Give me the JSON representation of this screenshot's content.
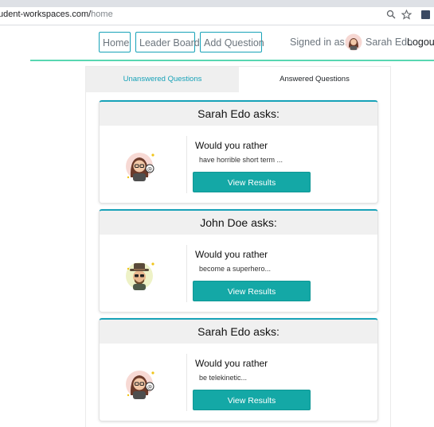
{
  "browser": {
    "url_host": "udent-workspaces.com/",
    "url_path": "home",
    "icons": [
      "zoom-icon",
      "star-icon",
      "extension-icon"
    ]
  },
  "nav": {
    "home_label": "Home",
    "leaderboard_label": "Leader Board",
    "add_question_label": "Add Question",
    "signed_in_label": "Signed in as:",
    "user_name": "Sarah Edo",
    "logout_label": "Logout",
    "accent_color": "#17a2b8"
  },
  "tabs": {
    "unanswered_label": "Unanswered Questions",
    "answered_label": "Answered Questions",
    "active": "Answered Questions"
  },
  "questions": [
    {
      "author_header": "Sarah Edo asks:",
      "avatar": "woman-with-glasses-avatar",
      "prompt": "Would you rather",
      "preview": "have horrible short term ...",
      "button_label": "View Results"
    },
    {
      "author_header": "John Doe asks:",
      "avatar": "man-with-hat-avatar",
      "prompt": "Would you rather",
      "preview": "become a superhero...",
      "button_label": "View Results"
    },
    {
      "author_header": "Sarah Edo asks:",
      "avatar": "woman-with-glasses-avatar",
      "prompt": "Would you rather",
      "preview": "be telekinetic...",
      "button_label": "View Results"
    }
  ],
  "colors": {
    "button_teal": "#14a8a6",
    "tab_active_text": "#17a2b8",
    "card_header_bg": "#f0f0f0"
  }
}
